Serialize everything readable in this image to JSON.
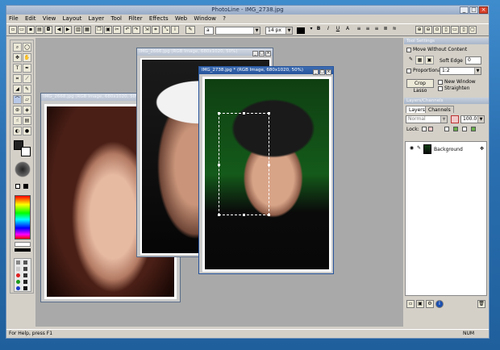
{
  "app": {
    "title": "PhotoLine - IMG_2738.jpg",
    "window_buttons": {
      "minimize": "_",
      "maximize": "□",
      "close": "×"
    }
  },
  "menu": [
    "File",
    "Edit",
    "View",
    "Layout",
    "Layer",
    "Tool",
    "Filter",
    "Effects",
    "Web",
    "Window",
    "?"
  ],
  "toolbar": {
    "font_size": "14 px",
    "bold": "B",
    "italic": "I",
    "underline": "U",
    "outline": "A"
  },
  "documents": [
    {
      "title": "IMG_2668.jpg  (RGB Image, 680x1020, 50%)"
    },
    {
      "title": "IMG_2666.jpg  (RGB Image, 680x1020, 50%)"
    },
    {
      "title": "IMG_2738.jpg * (RGB Image, 680x1020, 50%)"
    }
  ],
  "tool_settings": {
    "title": "Tool Settings",
    "move_without_content": "Move Without Content",
    "soft_edge_label": "Soft Edge",
    "soft_edge_value": "0",
    "proportional": "Proportional",
    "ratio": "1:2",
    "crop_lasso": "Crop Lasso",
    "new_window": "New Window",
    "straighten": "Straighten"
  },
  "layers_panel": {
    "title": "Layers/Channels",
    "tabs": [
      "Layers",
      "Channels"
    ],
    "blend_mode": "Normal",
    "opacity": "100.0 %",
    "lock_label": "Lock:",
    "layers": [
      {
        "name": "Background"
      }
    ]
  },
  "status": {
    "help": "For Help, press F1",
    "num": "NUM"
  },
  "colors": {
    "active_title": "#26539a",
    "desktop": "#2a6fb0",
    "ui_gray": "#d4d0c8"
  }
}
